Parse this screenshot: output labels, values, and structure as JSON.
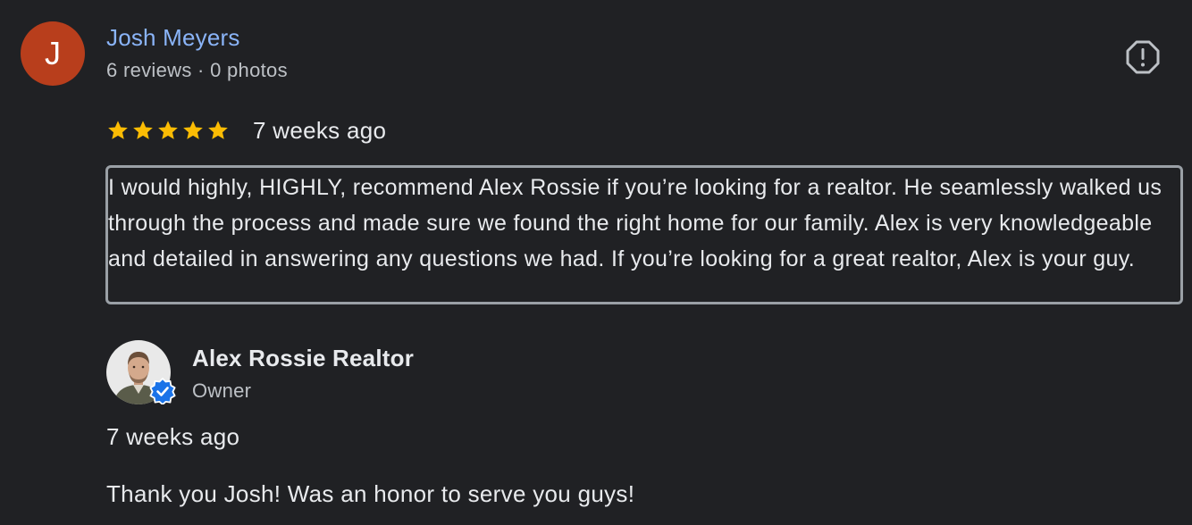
{
  "review": {
    "avatar_letter": "J",
    "reviewer_name": "Josh Meyers",
    "reviewer_meta": "6 reviews · 0 photos",
    "flag_icon": "report-icon",
    "rating": 5,
    "rating_max": 5,
    "time_ago": "7 weeks ago",
    "text": "I would highly, HIGHLY, recommend Alex Rossie if you’re looking for a realtor. He seamlessly walked us through the process and made sure we found the right home for our family. Alex is very knowledgeable and detailed in answering any questions we had. If you’re looking for a great realtor, Alex is your guy."
  },
  "owner_response": {
    "name": "Alex Rossie Realtor",
    "role": "Owner",
    "time_ago": "7 weeks ago",
    "text": "Thank you Josh! Was an honor to serve you guys!"
  },
  "colors": {
    "background": "#202124",
    "name_link": "#8ab4f8",
    "star": "#fbbc04",
    "avatar_bg": "#b83e1c",
    "verified_badge": "#1a73e8"
  }
}
